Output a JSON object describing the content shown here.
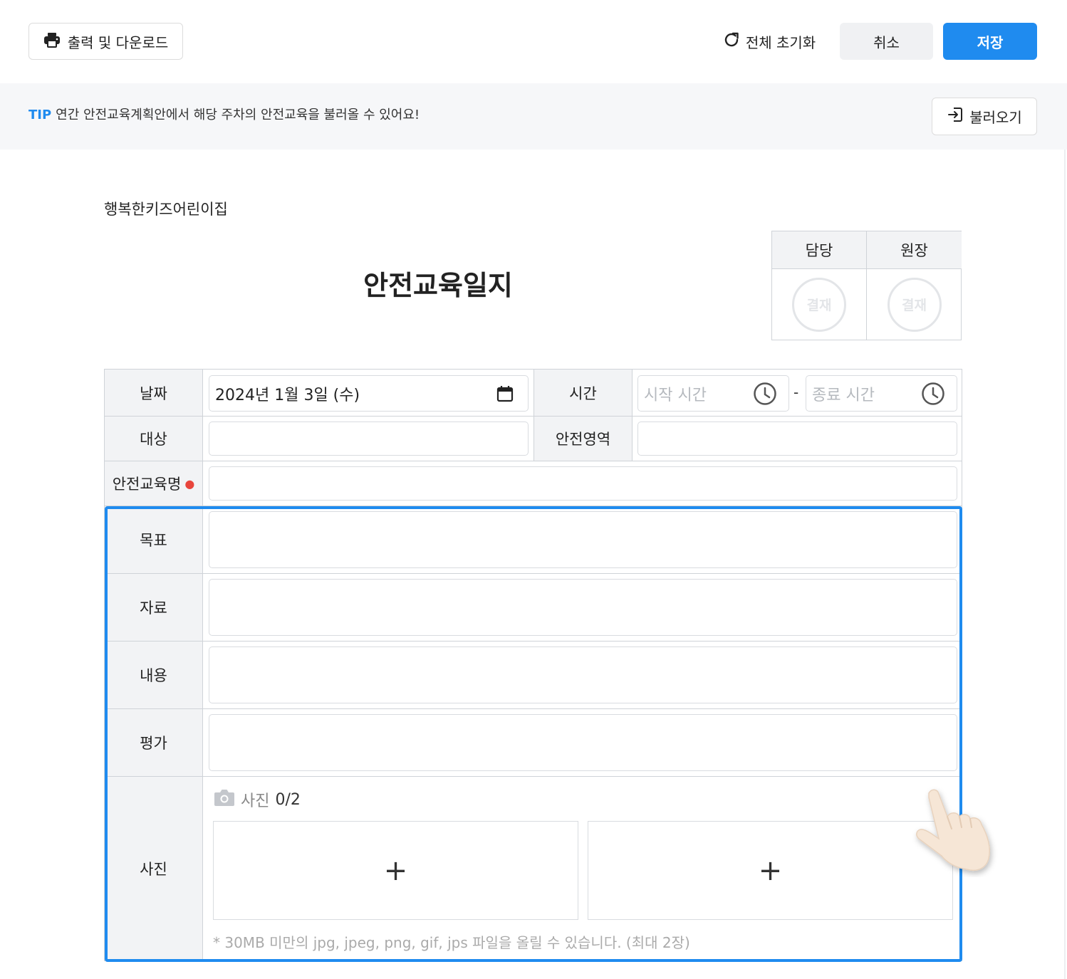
{
  "toolbar": {
    "print_label": "출력 및 다운로드",
    "reset_label": "전체 초기화",
    "cancel_label": "취소",
    "save_label": "저장"
  },
  "tip": {
    "label": "TIP",
    "text": "연간 안전교육계획안에서 해당 주차의 안전교육을 불러올 수 있어요!",
    "load_label": "불러오기"
  },
  "document": {
    "org_name": "행복한키즈어린이집",
    "title": "안전교육일지"
  },
  "approval": {
    "headers": [
      "담당",
      "원장"
    ],
    "stamps": [
      "결재",
      "결재"
    ]
  },
  "form": {
    "date_label": "날짜",
    "date_value": "2024년 1월 3일 (수)",
    "time_label": "시간",
    "start_time_placeholder": "시작 시간",
    "time_separator": "-",
    "end_time_placeholder": "종료 시간",
    "target_label": "대상",
    "target_value": "",
    "area_label": "안전영역",
    "area_value": "",
    "name_label": "안전교육명",
    "name_value": "",
    "goal_label": "목표",
    "material_label": "자료",
    "content_label": "내용",
    "evaluation_label": "평가",
    "photo_label": "사진",
    "photo_title": "사진",
    "photo_count": "0/2",
    "add_symbol": "+",
    "photo_note": "* 30MB 미만의 jpg, jpeg, png, gif, jps 파일을 올릴 수 있습니다. (최대 2장)"
  },
  "colors": {
    "accent": "#1f8bef",
    "required_dot": "#e8453c",
    "label_bg": "#f2f3f5",
    "tip_bg": "#f6f7f9"
  }
}
